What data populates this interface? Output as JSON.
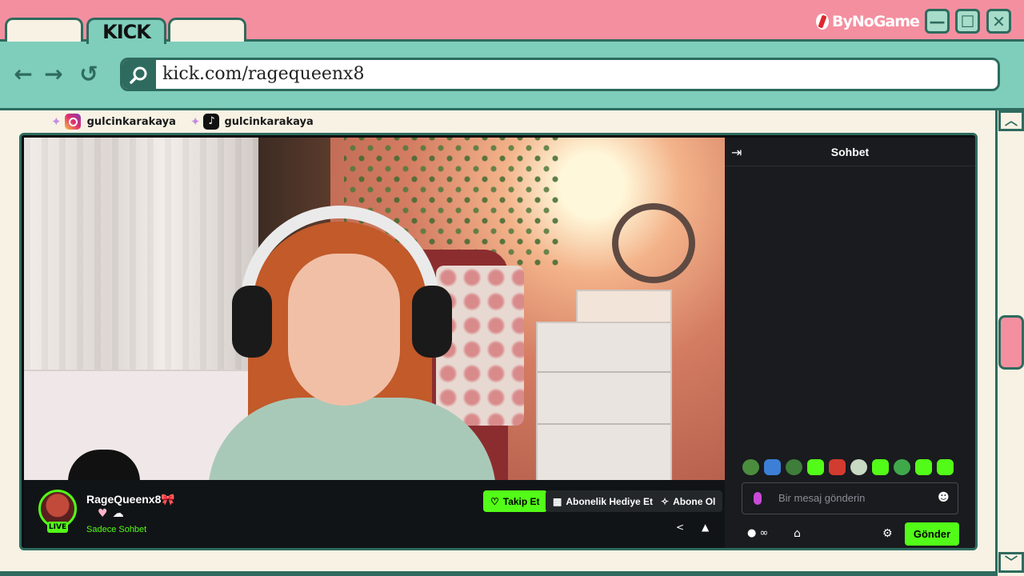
{
  "browser": {
    "tabs": [
      {
        "label": ""
      },
      {
        "label": "KICK"
      },
      {
        "label": ""
      }
    ],
    "brand": "ByNoGame",
    "url": "kick.com/ragequeenx8",
    "window_buttons": {
      "minimize": "—",
      "maximize": "☐",
      "close": "✕"
    },
    "nav": {
      "back": "←",
      "forward": "→",
      "reload": "↺"
    },
    "colors": {
      "frame": "#2e6b5e",
      "titlebar": "#f48fa0",
      "addressbar": "#7fcdbb",
      "kick_green": "#53fc18"
    }
  },
  "social": {
    "instagram": "gulcinkarakaya",
    "tiktok": "gulcinkarakaya"
  },
  "stream": {
    "streamer": "RageQueenx8🎀",
    "live_label": "LIVE",
    "category": "Sadece Sohbet",
    "follow_label": "Takip Et",
    "gift_label": "Abonelik Hediye Et",
    "subscribe_label": "Abone Ol"
  },
  "chat": {
    "title": "Sohbet",
    "placeholder": "Bir mesaj gönderin",
    "send_label": "Gönder",
    "points_label": "∞"
  }
}
